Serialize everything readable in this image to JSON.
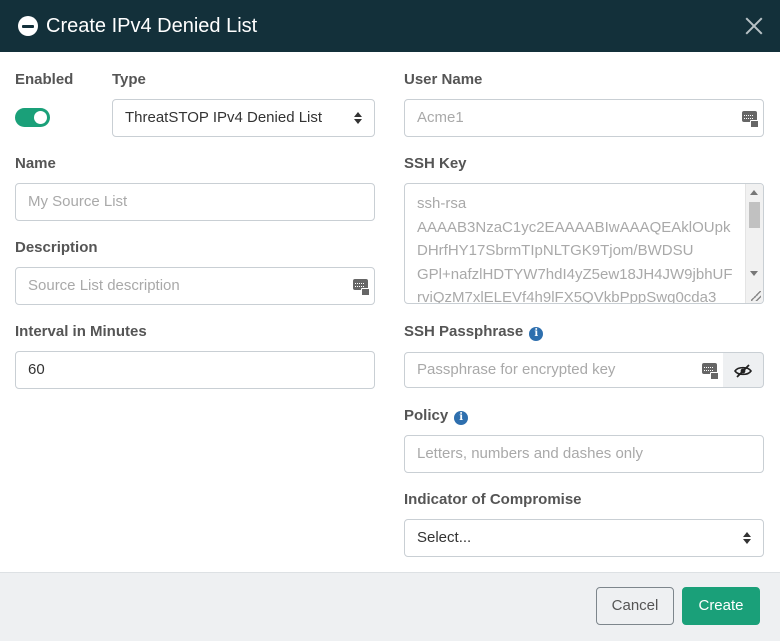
{
  "dialog": {
    "title": "Create IPv4 Denied List",
    "close_label": "×"
  },
  "form": {
    "enabled": {
      "label": "Enabled",
      "value": true,
      "accent": "#1aa079"
    },
    "type": {
      "label": "Type",
      "selected": "ThreatSTOP IPv4 Denied List"
    },
    "name": {
      "label": "Name",
      "placeholder": "My Source List"
    },
    "description": {
      "label": "Description",
      "placeholder": "Source List description"
    },
    "interval": {
      "label": "Interval in Minutes",
      "value": "60"
    },
    "user_name": {
      "label": "User Name",
      "placeholder": "Acme1"
    },
    "ssh_key": {
      "label": "SSH Key",
      "placeholder_lines": [
        "ssh-rsa",
        "AAAAB3NzaC1yc2EAAAABIwAAAQEAklOUpk",
        "DHrfHY17SbrmTIpNLTGK9Tjom/BWDSU",
        "GPl+nafzlHDTYW7hdI4yZ5ew18JH4JW9jbhUF",
        "rviQzM7xlELEVf4h9lFX5QVkbPppSwg0cda3"
      ]
    },
    "ssh_passphrase": {
      "label": "SSH Passphrase",
      "placeholder": "Passphrase for encrypted key",
      "info_icon": "info-icon",
      "toggle_icon": "eye-slash-icon"
    },
    "policy": {
      "label": "Policy",
      "placeholder": "Letters, numbers and dashes only",
      "info_icon": "info-icon"
    },
    "ioc": {
      "label": "Indicator of Compromise",
      "selected": "Select..."
    }
  },
  "footer": {
    "cancel_label": "Cancel",
    "create_label": "Create",
    "primary_color": "#1aa079"
  },
  "colors": {
    "header_bg": "#13303a",
    "info_blue": "#2e6fae"
  }
}
